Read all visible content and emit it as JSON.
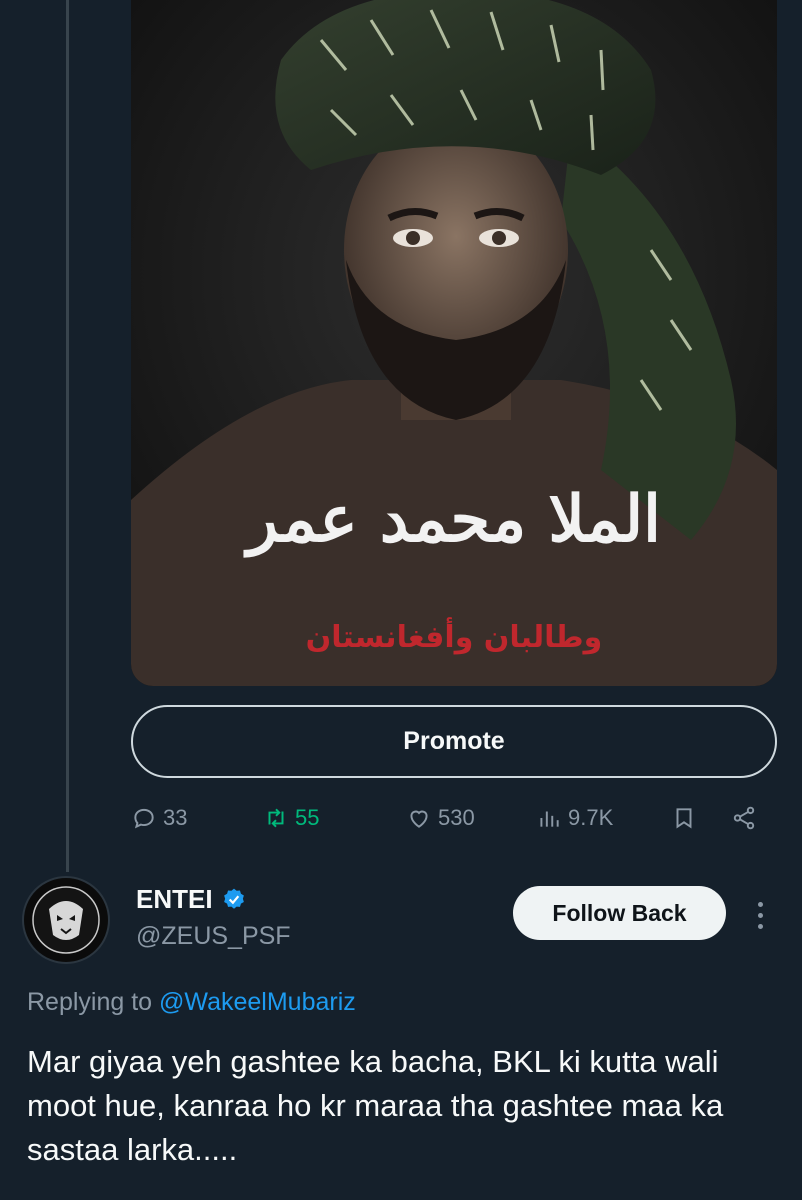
{
  "media": {
    "calligraphy_title": "الملا محمد عمر",
    "calligraphy_subtitle": "وطالبان وأفغانستان"
  },
  "promote": {
    "label": "Promote"
  },
  "actions": {
    "replies": "33",
    "retweets": "55",
    "likes": "530",
    "views": "9.7K"
  },
  "reply_tweet": {
    "display_name": "ENTEI",
    "handle": "@ZEUS_PSF",
    "follow_label": "Follow Back",
    "replying_prefix": "Replying to",
    "replying_to": "@WakeelMubariz",
    "text": "Mar giyaa yeh gashtee ka bacha, BKL ki kutta wali moot hue, kanraa ho kr maraa tha gashtee maa ka sastaa larka....."
  },
  "colors": {
    "background": "#15202b",
    "accent": "#1d9bf0",
    "retweet_green": "#00ba7c",
    "muted": "#8b98a5"
  },
  "icons": [
    "reply-icon",
    "retweet-icon",
    "like-icon",
    "views-icon",
    "bookmark-icon",
    "share-icon",
    "verified-icon",
    "more-icon"
  ]
}
